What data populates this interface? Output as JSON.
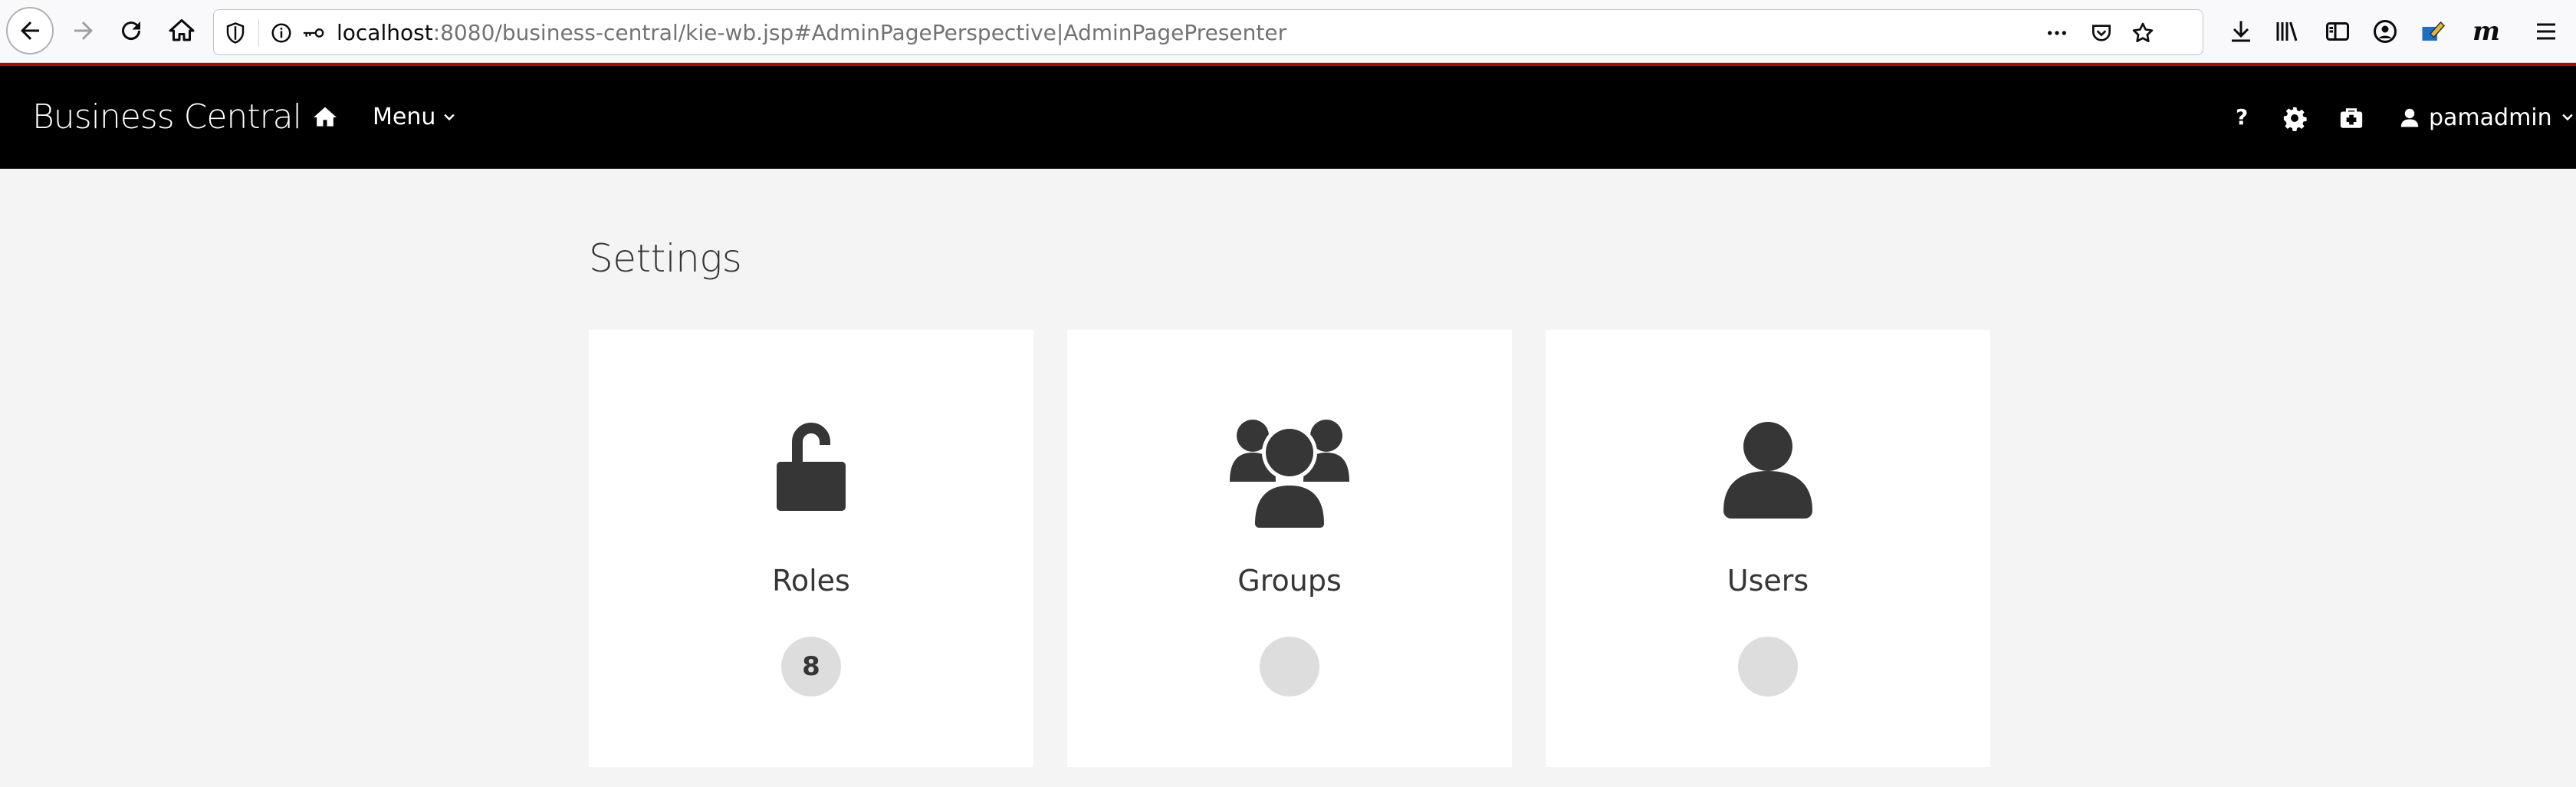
{
  "browser": {
    "url_host": "localhost",
    "url_rest": ":8080/business-central/kie-wb.jsp#AdminPagePerspective|AdminPagePresenter",
    "page_actions_icon": "more-horizontal-icon",
    "extension_label": "m"
  },
  "header": {
    "brand": "Business Central",
    "menu_label": "Menu",
    "help_label": "?",
    "user_label": "pamadmin"
  },
  "main": {
    "title": "Settings",
    "cards": [
      {
        "label": "Roles",
        "count": "8",
        "icon": "unlock-icon"
      },
      {
        "label": "Groups",
        "count": "",
        "icon": "users-icon"
      },
      {
        "label": "Users",
        "count": "",
        "icon": "user-icon"
      }
    ]
  },
  "colors": {
    "header_bg": "#000000",
    "accent_line": "#c00000",
    "page_bg": "#f4f4f4",
    "card_bg": "#ffffff",
    "icon_fill": "#363636",
    "badge_bg": "#dddddd"
  }
}
